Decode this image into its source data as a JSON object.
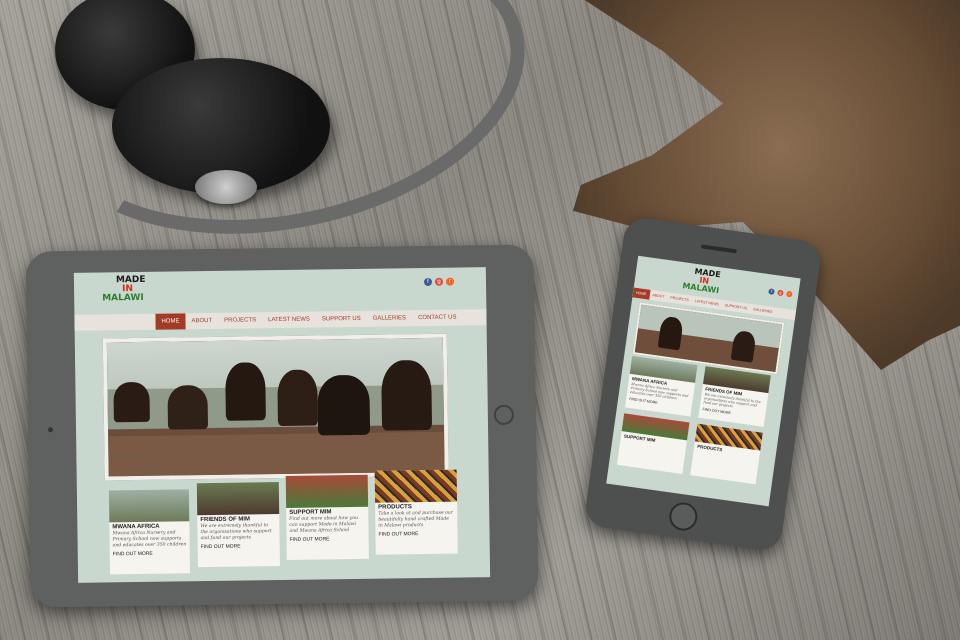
{
  "site": {
    "logo": {
      "line1": "MADE",
      "line2": "IN",
      "line3": "MALAWI"
    },
    "social": [
      {
        "icon": "facebook-icon",
        "glyph": "f",
        "color": "#3b5998"
      },
      {
        "icon": "google-plus-icon",
        "glyph": "g",
        "color": "#dd4b39"
      },
      {
        "icon": "rss-icon",
        "glyph": "r",
        "color": "#f26522"
      }
    ],
    "nav": [
      "HOME",
      "ABOUT",
      "PROJECTS",
      "LATEST NEWS",
      "SUPPORT US",
      "GALLERIES",
      "CONTACT US"
    ],
    "active_nav": "HOME",
    "cards": [
      {
        "title": "MWANA AFRICA",
        "desc": "Mwana Africa Nursery and Primary School now supports and educates over 350 children",
        "more": "FIND OUT MORE"
      },
      {
        "title": "FRIENDS OF MIM",
        "desc": "We are extremely thankful to the organisations who support and fund our projects",
        "more": "FIND OUT MORE"
      },
      {
        "title": "SUPPORT MIM",
        "desc": "Find out more about how you can support Made in Malawi and Mwana Africa School",
        "more": "FIND OUT MORE"
      },
      {
        "title": "PRODUCTS",
        "desc": "Take a look at and purchase our beautifully hand crafted Made in Malawi products",
        "more": "FIND OUT MORE"
      }
    ]
  },
  "colors": {
    "accent": "#a33b26",
    "screen_bg": "#c9d8cf",
    "nav_bg": "#e7e3dc"
  }
}
